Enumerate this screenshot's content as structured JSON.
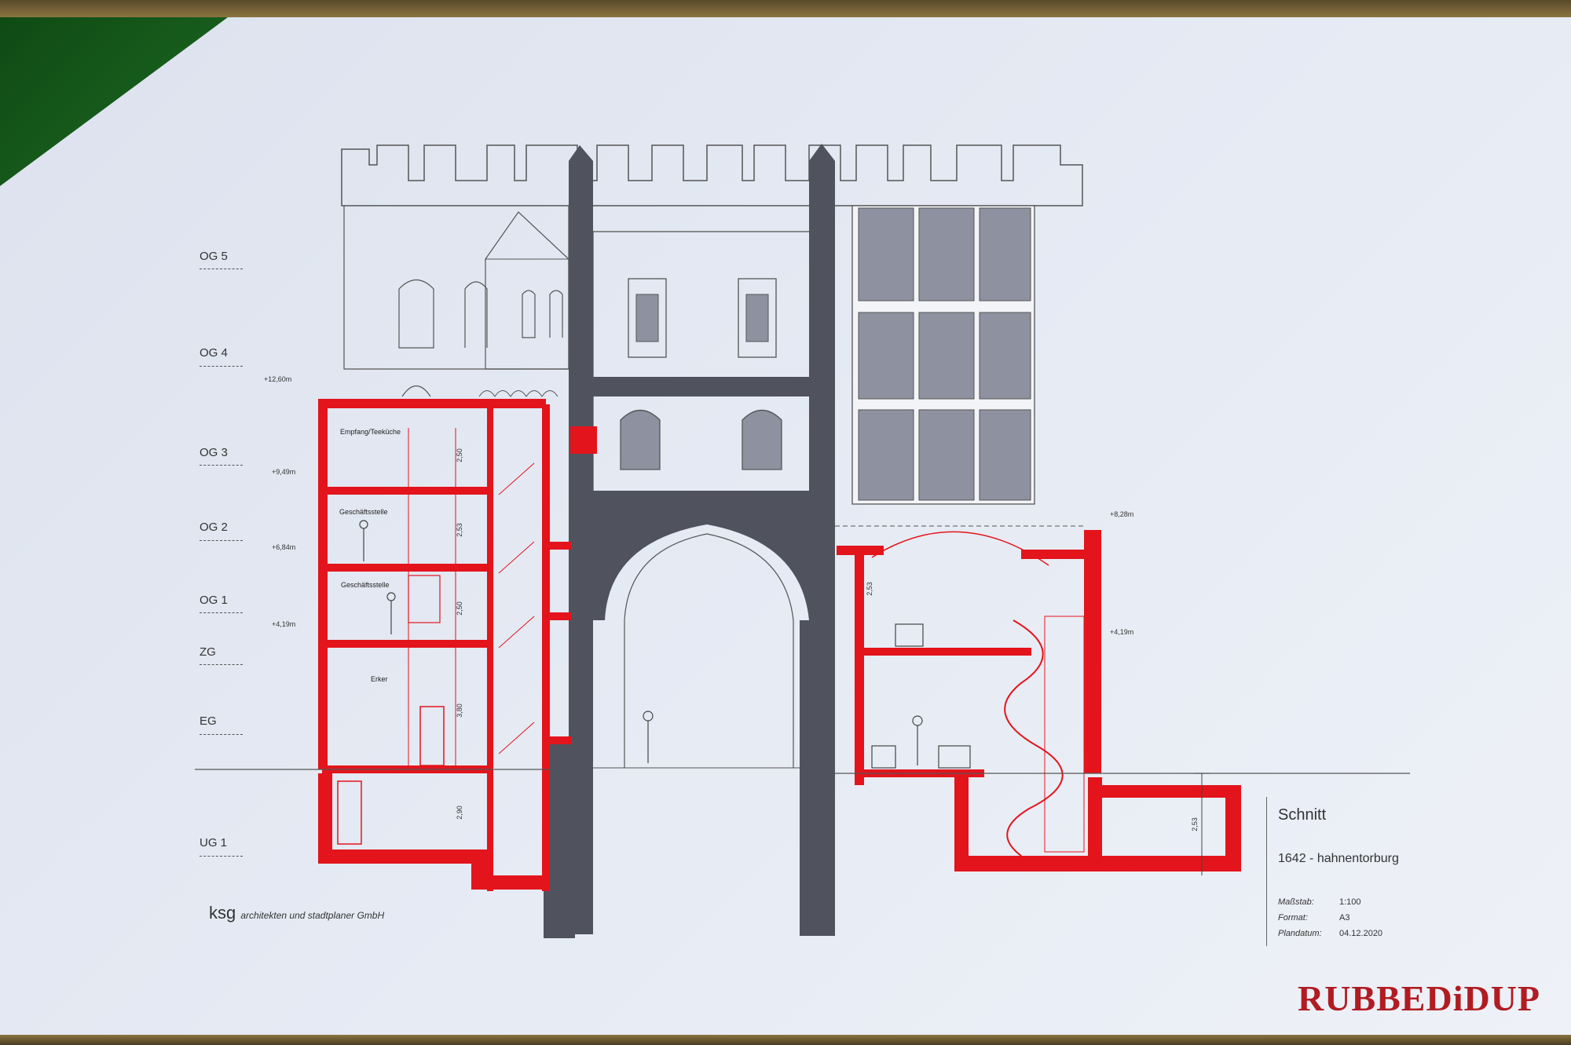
{
  "colors": {
    "section_red": "#e3141c",
    "facade_gray": "#50535e",
    "glass_gray": "#8e92a0",
    "logo_red": "#b01c22",
    "board_green": "#1d6a22"
  },
  "levels": [
    "OG 5",
    "OG 4",
    "OG 3",
    "OG 2",
    "OG 1",
    "ZG",
    "EG",
    "UG 1"
  ],
  "elevations_left": [
    "+12,60m",
    "+9,49m",
    "+6,84m",
    "+4,19m"
  ],
  "elevations_right": [
    "+8,28m",
    "+4,19m"
  ],
  "rooms": {
    "r1": "Empfang/Teeküche",
    "r2": "Geschäftsstelle",
    "r3": "Geschäftsstelle",
    "r4": "Erker"
  },
  "dims": [
    "2,50",
    "2,53",
    "2,50",
    "3,80",
    "2,90",
    "2,53",
    "2,53"
  ],
  "title_block": {
    "title": "Schnitt",
    "project": "1642 - hahnentorburg",
    "rows": [
      {
        "label": "Maßstab:",
        "value": "1:100"
      },
      {
        "label": "Format:",
        "value": "A3"
      },
      {
        "label": "Plandatum:",
        "value": "04.12.2020"
      }
    ]
  },
  "architect": {
    "logo": "ksg",
    "name": "architekten und stadtplaner GmbH"
  },
  "logo": {
    "text": "RUBBEDiDUP"
  }
}
